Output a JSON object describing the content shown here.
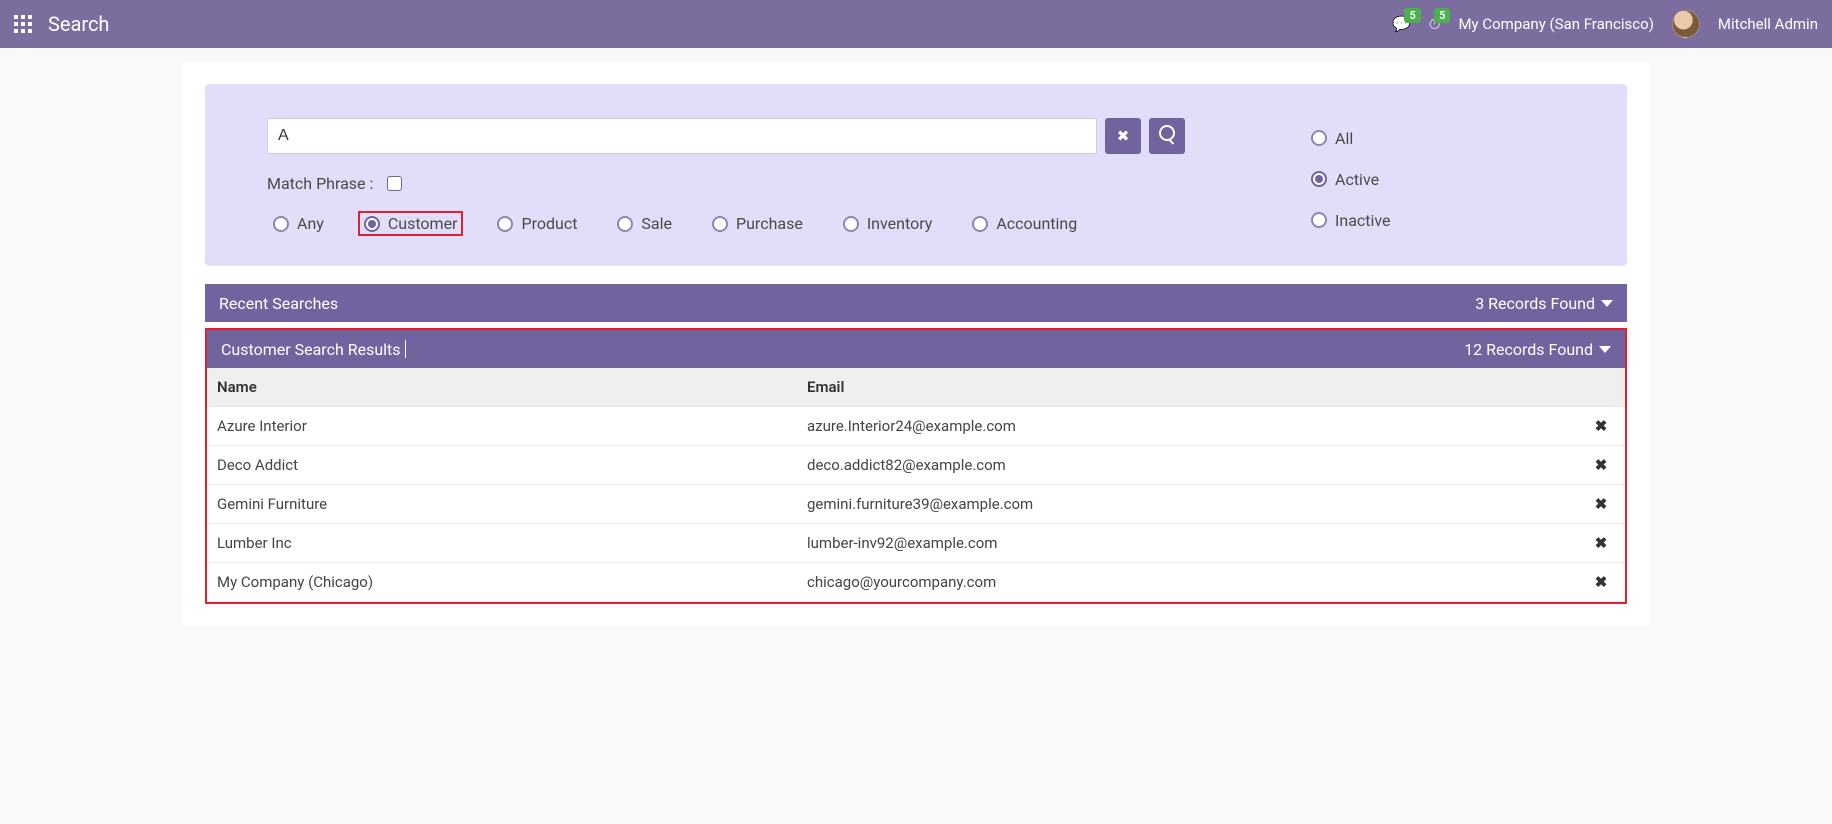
{
  "topbar": {
    "title": "Search",
    "messages_badge": "5",
    "activities_badge": "5",
    "company": "My Company (San Francisco)",
    "user": "Mitchell Admin"
  },
  "search": {
    "query": "A",
    "match_phrase_label": "Match Phrase :",
    "match_phrase_checked": false,
    "categories": [
      {
        "key": "any",
        "label": "Any",
        "checked": false,
        "highlighted": false
      },
      {
        "key": "customer",
        "label": "Customer",
        "checked": true,
        "highlighted": true
      },
      {
        "key": "product",
        "label": "Product",
        "checked": false,
        "highlighted": false
      },
      {
        "key": "sale",
        "label": "Sale",
        "checked": false,
        "highlighted": false
      },
      {
        "key": "purchase",
        "label": "Purchase",
        "checked": false,
        "highlighted": false
      },
      {
        "key": "inventory",
        "label": "Inventory",
        "checked": false,
        "highlighted": false
      },
      {
        "key": "accounting",
        "label": "Accounting",
        "checked": false,
        "highlighted": false
      }
    ],
    "status_filters": [
      {
        "key": "all",
        "label": "All",
        "checked": false
      },
      {
        "key": "active",
        "label": "Active",
        "checked": true
      },
      {
        "key": "inactive",
        "label": "Inactive",
        "checked": false
      }
    ]
  },
  "recent": {
    "title": "Recent Searches",
    "count_label": "3 Records Found"
  },
  "results": {
    "title": "Customer Search Results",
    "count_label": "12 Records Found",
    "columns": {
      "name": "Name",
      "email": "Email"
    },
    "rows": [
      {
        "name": "Azure Interior",
        "email": "azure.Interior24@example.com"
      },
      {
        "name": "Deco Addict",
        "email": "deco.addict82@example.com"
      },
      {
        "name": "Gemini Furniture",
        "email": "gemini.furniture39@example.com"
      },
      {
        "name": "Lumber Inc",
        "email": "lumber-inv92@example.com"
      },
      {
        "name": "My Company (Chicago)",
        "email": "chicago@yourcompany.com"
      }
    ]
  }
}
